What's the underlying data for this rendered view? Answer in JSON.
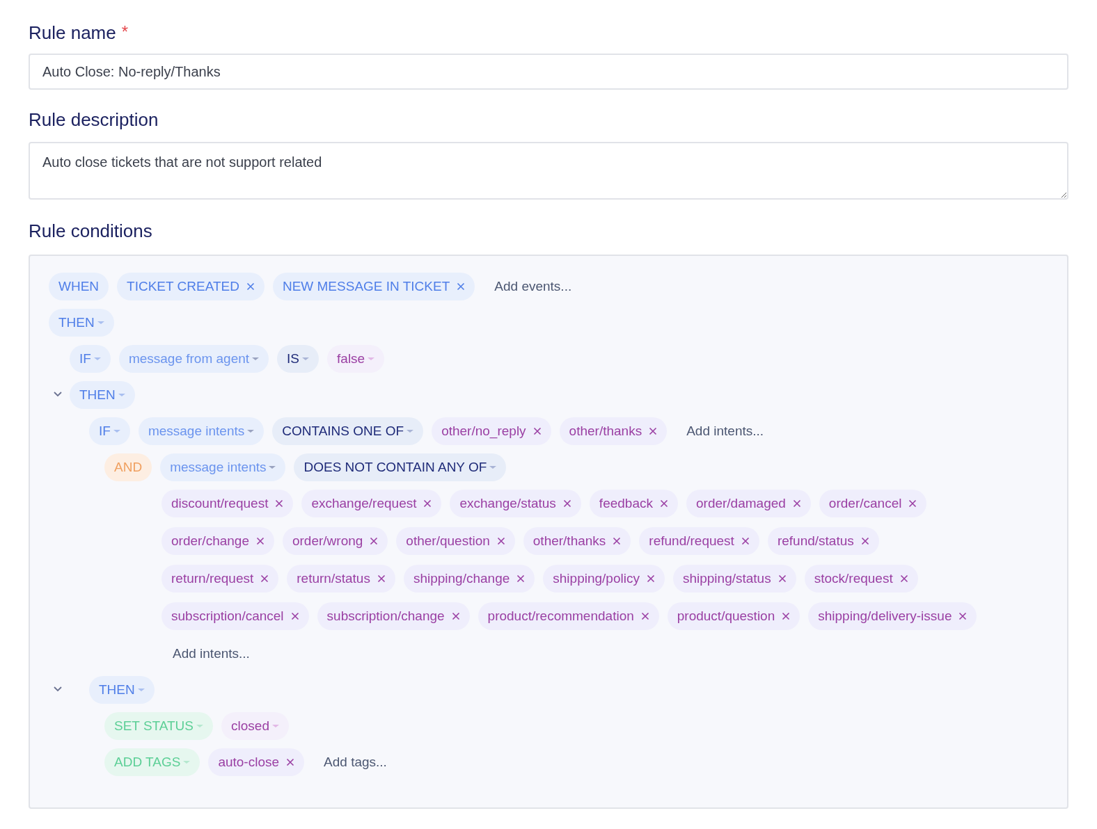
{
  "rule_name": {
    "label": "Rule name",
    "required_mark": "*",
    "value": "Auto Close: No-reply/Thanks"
  },
  "rule_description": {
    "label": "Rule description",
    "value": "Auto close tickets that are not support related"
  },
  "rule_conditions": {
    "label": "Rule conditions",
    "rows": [
      {
        "chips": [
          {
            "kind": "keyword",
            "text": "WHEN"
          },
          {
            "kind": "keyword",
            "text": "TICKET CREATED",
            "removable": true
          },
          {
            "kind": "keyword",
            "text": "NEW MESSAGE IN TICKET",
            "removable": true
          },
          {
            "kind": "add",
            "text": "Add events..."
          }
        ]
      },
      {
        "chips": [
          {
            "kind": "keyword",
            "text": "THEN",
            "dropdown": true
          }
        ],
        "children": [
          {
            "chips": [
              {
                "kind": "keyword",
                "text": "IF",
                "dropdown": true
              },
              {
                "kind": "field",
                "text": "message from agent",
                "dropdown": true
              },
              {
                "kind": "operator",
                "text": "IS",
                "dropdown": true
              },
              {
                "kind": "boolean",
                "text": "false",
                "dropdown": true
              }
            ]
          },
          {
            "expanded": true,
            "chips": [
              {
                "kind": "keyword",
                "text": "THEN",
                "dropdown": true
              }
            ],
            "children": [
              {
                "chips": [
                  {
                    "kind": "keyword",
                    "text": "IF",
                    "dropdown": true
                  },
                  {
                    "kind": "field",
                    "text": "message intents",
                    "dropdown": true
                  },
                  {
                    "kind": "operator",
                    "text": "CONTAINS ONE OF",
                    "dropdown": true
                  },
                  {
                    "kind": "value",
                    "text": "other/no_reply",
                    "removable": true
                  },
                  {
                    "kind": "value",
                    "text": "other/thanks",
                    "removable": true
                  },
                  {
                    "kind": "add",
                    "text": "Add intents..."
                  }
                ],
                "children": [
                  {
                    "chips": [
                      {
                        "kind": "conjunction",
                        "text": "AND"
                      },
                      {
                        "kind": "field",
                        "text": "message intents",
                        "dropdown": true
                      },
                      {
                        "kind": "operator",
                        "text": "DOES NOT CONTAIN ANY OF",
                        "dropdown": true
                      }
                    ],
                    "values": [
                      {
                        "kind": "value",
                        "text": "discount/request",
                        "removable": true
                      },
                      {
                        "kind": "value",
                        "text": "exchange/request",
                        "removable": true
                      },
                      {
                        "kind": "value",
                        "text": "exchange/status",
                        "removable": true
                      },
                      {
                        "kind": "value",
                        "text": "feedback",
                        "removable": true
                      },
                      {
                        "kind": "value",
                        "text": "order/damaged",
                        "removable": true
                      },
                      {
                        "kind": "value",
                        "text": "order/cancel",
                        "removable": true
                      },
                      {
                        "kind": "value",
                        "text": "order/change",
                        "removable": true
                      },
                      {
                        "kind": "value",
                        "text": "order/wrong",
                        "removable": true
                      },
                      {
                        "kind": "value",
                        "text": "other/question",
                        "removable": true
                      },
                      {
                        "kind": "value",
                        "text": "other/thanks",
                        "removable": true
                      },
                      {
                        "kind": "value",
                        "text": "refund/request",
                        "removable": true
                      },
                      {
                        "kind": "value",
                        "text": "refund/status",
                        "removable": true
                      },
                      {
                        "kind": "value",
                        "text": "return/request",
                        "removable": true
                      },
                      {
                        "kind": "value",
                        "text": "return/status",
                        "removable": true
                      },
                      {
                        "kind": "value",
                        "text": "shipping/change",
                        "removable": true
                      },
                      {
                        "kind": "value",
                        "text": "shipping/policy",
                        "removable": true
                      },
                      {
                        "kind": "value",
                        "text": "shipping/status",
                        "removable": true
                      },
                      {
                        "kind": "value",
                        "text": "stock/request",
                        "removable": true
                      },
                      {
                        "kind": "value",
                        "text": "subscription/cancel",
                        "removable": true
                      },
                      {
                        "kind": "value",
                        "text": "subscription/change",
                        "removable": true
                      },
                      {
                        "kind": "value",
                        "text": "product/recommendation",
                        "removable": true
                      },
                      {
                        "kind": "value",
                        "text": "product/question",
                        "removable": true
                      },
                      {
                        "kind": "value",
                        "text": "shipping/delivery-issue",
                        "removable": true
                      },
                      {
                        "kind": "add",
                        "text": "Add intents..."
                      }
                    ]
                  }
                ]
              },
              {
                "expanded": true,
                "chips": [
                  {
                    "kind": "keyword",
                    "text": "THEN",
                    "dropdown": true
                  }
                ],
                "children": [
                  {
                    "chips": [
                      {
                        "kind": "action",
                        "text": "SET STATUS",
                        "dropdown": true
                      },
                      {
                        "kind": "boolean",
                        "text": "closed",
                        "dropdown": true
                      }
                    ]
                  },
                  {
                    "chips": [
                      {
                        "kind": "action",
                        "text": "ADD TAGS",
                        "dropdown": true
                      },
                      {
                        "kind": "value",
                        "text": "auto-close",
                        "removable": true
                      },
                      {
                        "kind": "add",
                        "text": "Add tags..."
                      }
                    ]
                  }
                ]
              }
            ]
          }
        ]
      }
    ]
  }
}
